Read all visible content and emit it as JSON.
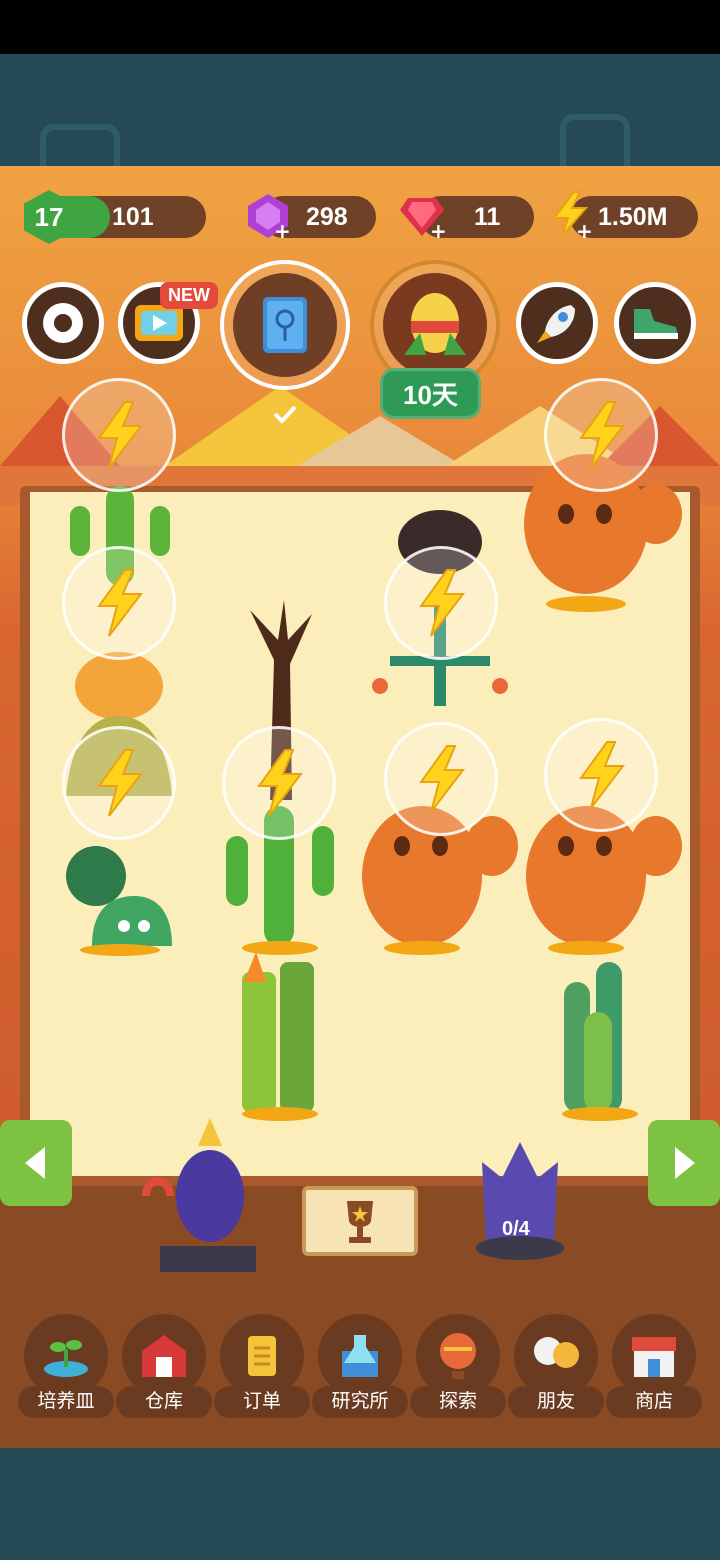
{
  "currency": {
    "level": "17",
    "level_progress": 0.35,
    "xp": "101",
    "purple_gems": "298",
    "red_gems": "11",
    "energy": "1.50M"
  },
  "buttons": {
    "new_badge": "NEW",
    "event_days": "10天"
  },
  "statue": {
    "progress": "0/4"
  },
  "nav": {
    "items": [
      {
        "label": "培养皿",
        "icon": "sprout-dish-icon"
      },
      {
        "label": "仓库",
        "icon": "barn-icon"
      },
      {
        "label": "订单",
        "icon": "scroll-icon"
      },
      {
        "label": "研究所",
        "icon": "lab-icon"
      },
      {
        "label": "探索",
        "icon": "balloon-icon"
      },
      {
        "label": "朋友",
        "icon": "friends-icon"
      },
      {
        "label": "商店",
        "icon": "shop-icon"
      }
    ]
  },
  "colors": {
    "accent_green": "#3fa543",
    "board": "#fbeebb",
    "frame": "#a85a2c",
    "pill": "#6f4227"
  }
}
